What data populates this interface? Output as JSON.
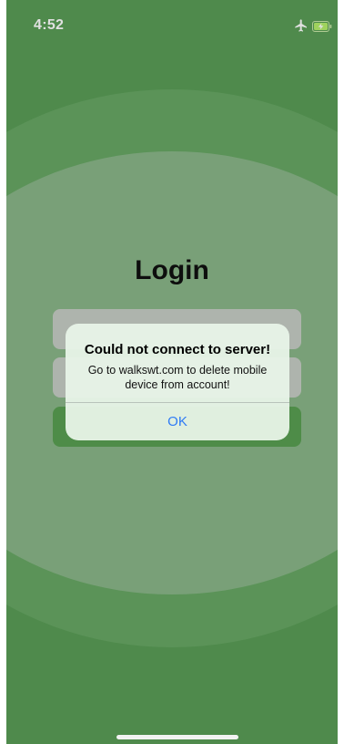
{
  "status_bar": {
    "time": "4:52",
    "airplane_icon": "airplane-icon",
    "battery_icon": "battery-charging-icon"
  },
  "login": {
    "title": "Login"
  },
  "alert": {
    "title": "Could not connect to server!",
    "message": "Go to walkswt.com to delete mobile device from account!",
    "ok_label": "OK"
  },
  "colors": {
    "background": "#5a9e57",
    "circle_outer": "#68a865",
    "circle_inner": "#8ab789",
    "button_green": "#59a052",
    "link_blue": "#2f7bf5"
  }
}
